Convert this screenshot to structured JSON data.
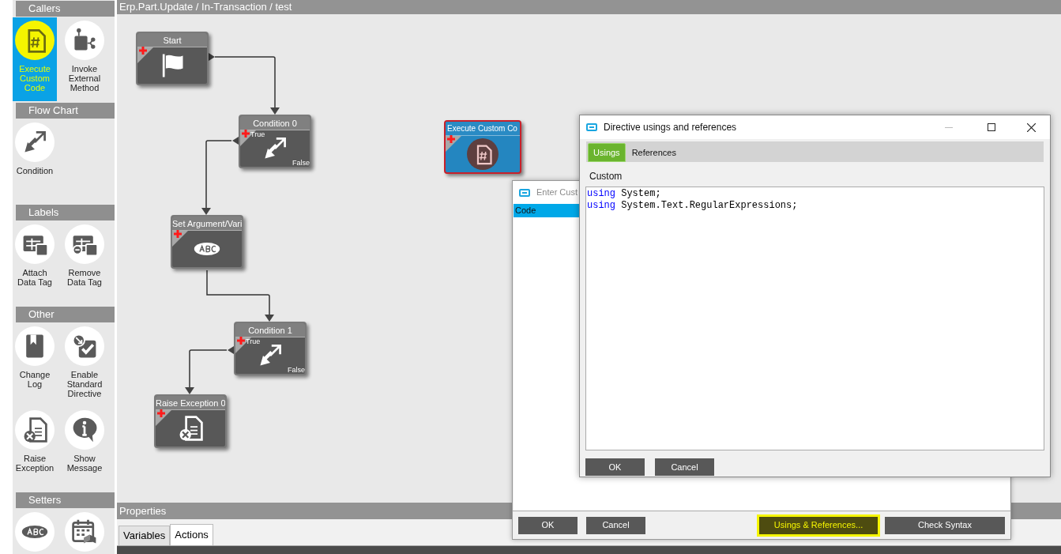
{
  "palette": {
    "sections": [
      {
        "title": "Callers",
        "items": [
          {
            "label": "Execute Custom Code",
            "kind": "code",
            "selected": true
          },
          {
            "label": "Invoke External Method",
            "kind": "invoke",
            "selected": false
          }
        ]
      },
      {
        "title": "Flow Chart",
        "items": [
          {
            "label": "Condition",
            "kind": "condition",
            "selected": false
          }
        ]
      },
      {
        "title": "Labels",
        "items": [
          {
            "label": "Attach Data Tag",
            "kind": "attach",
            "selected": false
          },
          {
            "label": "Remove Data Tag",
            "kind": "remove",
            "selected": false
          }
        ]
      },
      {
        "title": "Other",
        "items": [
          {
            "label": "Change Log",
            "kind": "log",
            "selected": false
          },
          {
            "label": "Enable Standard Directive",
            "kind": "enable",
            "selected": false
          },
          {
            "label": "Raise Exception",
            "kind": "raise",
            "selected": false
          },
          {
            "label": "Show Message",
            "kind": "message",
            "selected": false
          }
        ]
      },
      {
        "title": "Setters",
        "items": [
          {
            "kind": "abc",
            "selected": false
          },
          {
            "kind": "calendar",
            "selected": false
          }
        ]
      }
    ]
  },
  "breadcrumb": "Erp.Part.Update / In-Transaction / test",
  "nodes": [
    {
      "title": "Start",
      "kind": "start"
    },
    {
      "title": "Condition 0",
      "kind": "condition",
      "true_label": "True",
      "false_label": "False"
    },
    {
      "title": "Set Argument/Vari",
      "kind": "abc"
    },
    {
      "title": "Condition 1",
      "kind": "condition",
      "true_label": "True",
      "false_label": "False"
    },
    {
      "title": "Raise Exception 0",
      "kind": "raise"
    },
    {
      "title": "Execute Custom Co",
      "kind": "code"
    }
  ],
  "properties": {
    "title": "Properties",
    "tabs": [
      {
        "label": "Variables",
        "selected": false
      },
      {
        "label": "Actions",
        "selected": true
      }
    ]
  },
  "code_dialog": {
    "title": "Enter Cust",
    "code_header": "Code",
    "buttons": [
      {
        "label": "OK",
        "highlighted": false
      },
      {
        "label": "Cancel",
        "highlighted": false
      },
      {
        "label": "Usings & References...",
        "highlighted": true
      },
      {
        "label": "Check Syntax",
        "highlighted": false
      }
    ]
  },
  "directive_dialog": {
    "title": "Directive usings and references",
    "tabs": [
      {
        "label": "Usings",
        "selected": true
      },
      {
        "label": "References",
        "selected": false
      }
    ],
    "section_label": "Custom",
    "code_lines": [
      {
        "keyword": "using",
        "rest": "System;"
      },
      {
        "keyword": "using",
        "rest": "System.Text.RegularExpressions;"
      }
    ],
    "buttons": [
      "OK",
      "Cancel"
    ]
  }
}
